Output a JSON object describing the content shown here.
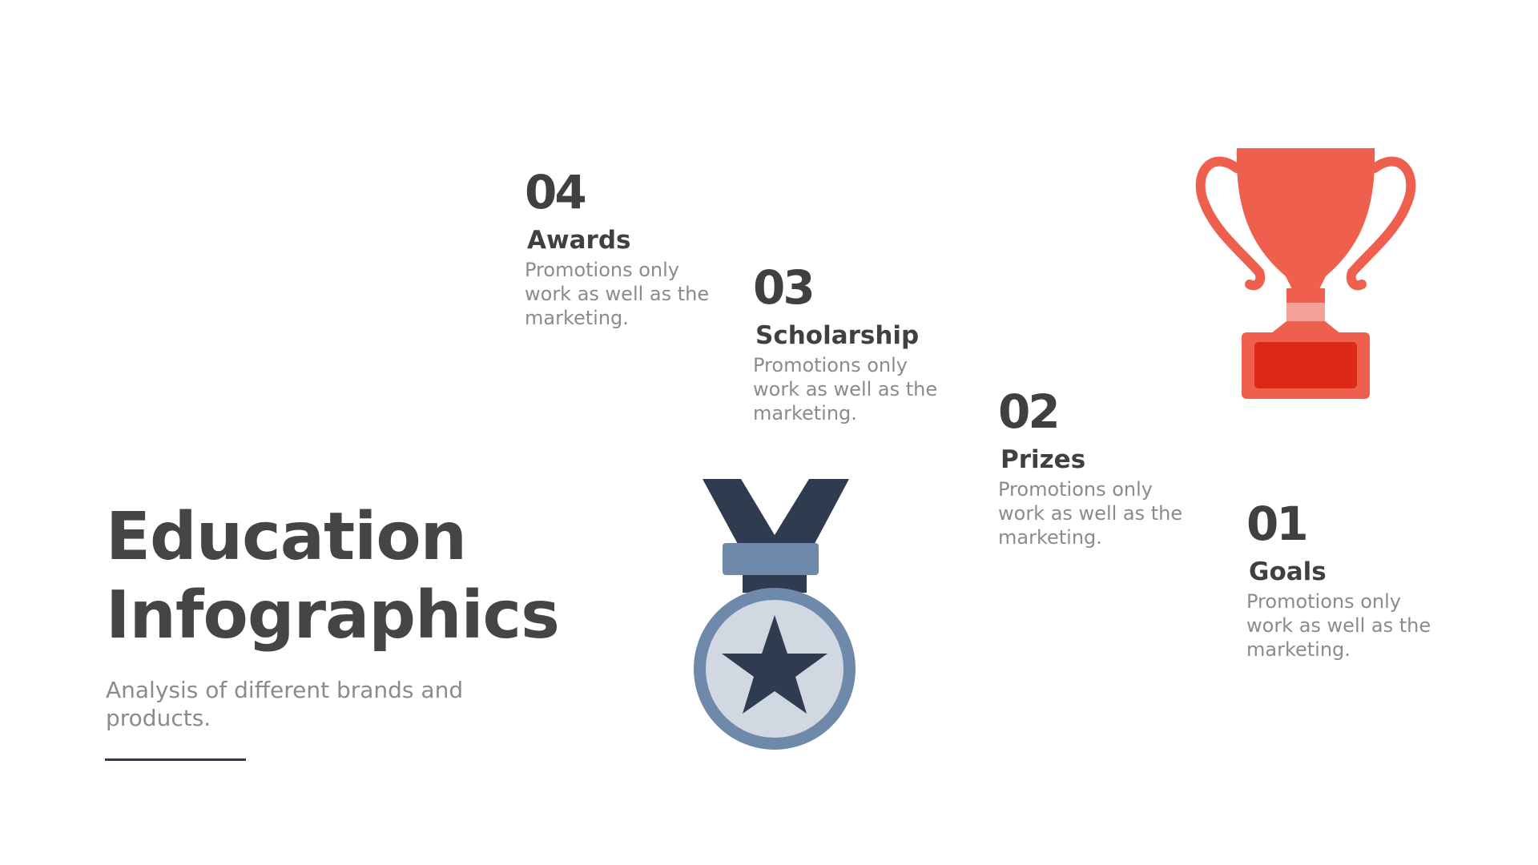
{
  "title": {
    "line1": "Education",
    "line2": "Infographics"
  },
  "subtitle": "Analysis of different brands and products.",
  "steps": [
    {
      "number": "04",
      "label": "Awards",
      "description": "Promotions only work as well as the marketing."
    },
    {
      "number": "03",
      "label": "Scholarship",
      "description": "Promotions only work as well as the marketing."
    },
    {
      "number": "02",
      "label": "Prizes",
      "description": "Promotions only work as well as the marketing."
    },
    {
      "number": "01",
      "label": "Goals",
      "description": "Promotions only work as well as the marketing."
    }
  ],
  "icons": {
    "medal": "medal-icon",
    "trophy": "trophy-icon"
  },
  "colors": {
    "heading": "#404040",
    "body_text": "#8b8b8b",
    "divider": "#2f3a58",
    "medal_dark": "#2f3c50",
    "medal_blue": "#6f89ab",
    "medal_light": "#d2d8e2",
    "trophy_red": "#ef5f4e",
    "trophy_pink": "#f5a19a",
    "trophy_plate": "#dc2a16"
  }
}
